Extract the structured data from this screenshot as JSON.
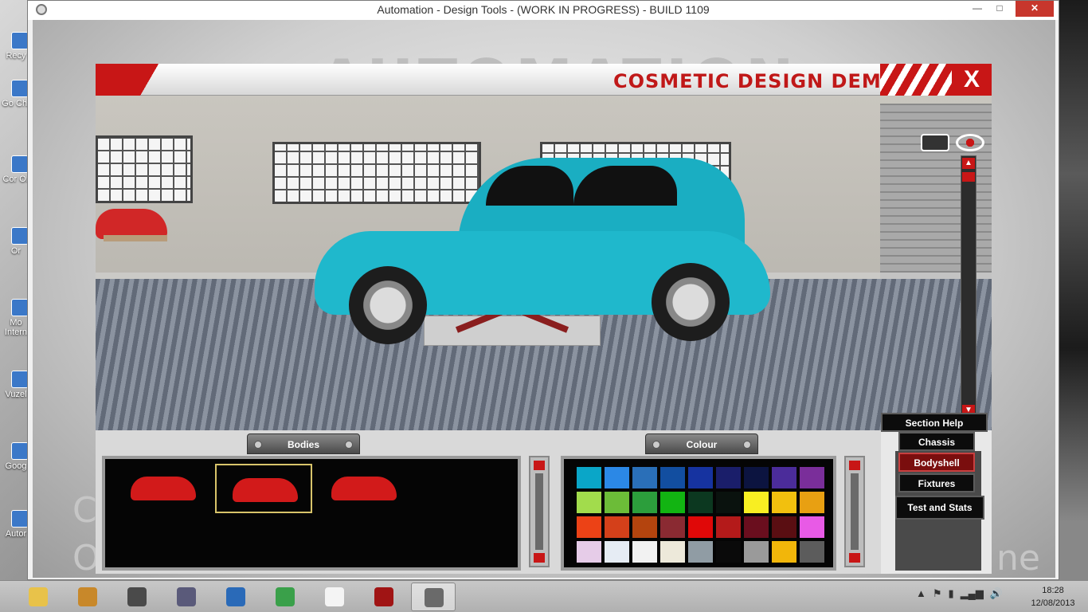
{
  "window": {
    "title": "Automation - Design Tools - (WORK IN PROGRESS) - BUILD 1109",
    "minimize": "—",
    "maximize": "□",
    "close": "✕"
  },
  "background": {
    "logo": "AUTOMATION",
    "ghost_left_1": "C",
    "ghost_left_2": "O",
    "ghost_right": "ne"
  },
  "desktop_icons": [
    "Recy",
    "Go Chr",
    "Cor Or",
    "Or",
    "Mo Intern",
    "Vuzel",
    "Goog",
    "Autor"
  ],
  "panel": {
    "title": "COSMETIC DESIGN DEMO",
    "close_label": "X"
  },
  "scene": {
    "car_color": "#1fb8cc",
    "scroll_up": "▲",
    "scroll_down": "▼"
  },
  "bodies": {
    "tab_label": "Bodies",
    "items": [
      {
        "name": "hatchback",
        "selected": false
      },
      {
        "name": "sedan",
        "selected": true
      },
      {
        "name": "coupe",
        "selected": false
      }
    ]
  },
  "colour": {
    "tab_label": "Colour",
    "swatches": [
      "#0aa6c8",
      "#2b88e6",
      "#2a6fb8",
      "#124ea0",
      "#1633a0",
      "#1a1e6a",
      "#0c1440",
      "#4b2c9a",
      "#7a2e9a",
      "#a2dc4c",
      "#6cbc38",
      "#2c9e3c",
      "#12b412",
      "#0c3820",
      "#0a120e",
      "#f8ee22",
      "#f2c00e",
      "#e8a012",
      "#ec4216",
      "#d4401a",
      "#b4440e",
      "#8a2a32",
      "#e00808",
      "#b41a1a",
      "#6a0e1e",
      "#5a0e12",
      "#e85ae6",
      "#e6cce8",
      "#e6ecf4",
      "#f2f2f2",
      "#ede9da",
      "#909ca4",
      "#0a0a0a",
      "#9a9a9a",
      "#f2b60a",
      "#5c5c5c"
    ]
  },
  "menu": {
    "section_help": "Section Help",
    "chassis": "Chassis",
    "bodyshell": "Bodyshell",
    "fixtures": "Fixtures",
    "test_stats": "Test and Stats"
  },
  "taskbar": {
    "items": [
      {
        "name": "file-explorer",
        "color": "#e8c24a"
      },
      {
        "name": "app-gold",
        "color": "#c8882a"
      },
      {
        "name": "speaker-app",
        "color": "#4a4a4a"
      },
      {
        "name": "doc-app",
        "color": "#5a5a7a"
      },
      {
        "name": "settings-app",
        "color": "#2a6ab8"
      },
      {
        "name": "chrome",
        "color": "#3aa04a"
      },
      {
        "name": "blank-doc",
        "color": "#f4f4f4"
      },
      {
        "name": "power-app",
        "color": "#a01414"
      },
      {
        "name": "automation-app",
        "color": "#6a6a6a"
      }
    ],
    "tray_icons": [
      "▲",
      "⚑",
      "▮",
      "▂▄▆",
      "🔊"
    ],
    "time": "18:28",
    "date": "12/08/2013"
  }
}
